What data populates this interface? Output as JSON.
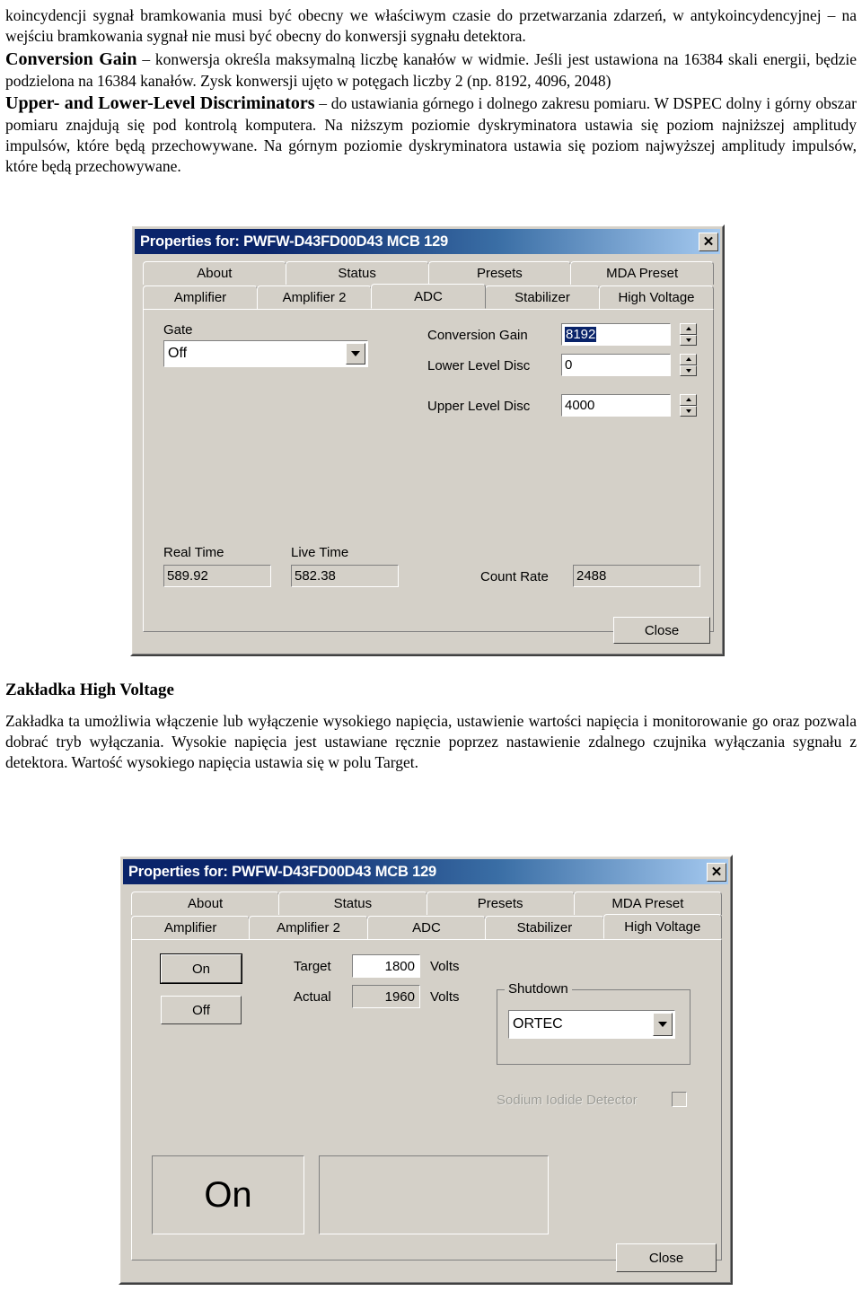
{
  "document": {
    "paragraph1": "koincydencji sygnał bramkowania musi być obecny we właściwym czasie do przetwarzania zdarzeń, w antykoincydencyjnej – na wejściu bramkowania sygnał nie musi być obecny do konwersji sygnału detektora.",
    "term1": "Conversion Gain",
    "paragraph2": " – konwersja określa maksymalną liczbę kanałów w widmie. Jeśli jest ustawiona na 16384 skali energii, będzie podzielona na 16384 kanałów. Zysk konwersji ujęto w potęgach liczby 2 (np. 8192, 4096, 2048)",
    "term2": "Upper- and Lower-Level Discriminators",
    "paragraph3": " – do ustawiania górnego i dolnego zakresu pomiaru. W DSPEC dolny i górny obszar pomiaru znajdują się pod kontrolą komputera. Na niższym poziomie dyskryminatora ustawia się poziom najniższej amplitudy impulsów, które będą przechowywane. Na górnym poziomie dyskryminatora ustawia się poziom najwyższej amplitudy impulsów, które będą przechowywane.",
    "heading_hv": "Zakładka High Voltage",
    "paragraph4": "Zakładka ta umożliwia włączenie lub wyłączenie wysokiego napięcia, ustawienie wartości napięcia i monitorowanie go oraz pozwala dobrać tryb wyłączania. Wysokie napięcia jest ustawiane ręcznie poprzez nastawienie zdalnego czujnika wyłączania sygnału z detektora. Wartość wysokiego napięcia ustawia się w polu Target."
  },
  "dialog_adc": {
    "title": "Properties for: PWFW-D43FD00D43 MCB 129",
    "close_icon_label": "✕",
    "tabs_top": [
      {
        "label": "About",
        "active": false
      },
      {
        "label": "Status",
        "active": false
      },
      {
        "label": "Presets",
        "active": false
      },
      {
        "label": "MDA Preset",
        "active": false
      }
    ],
    "tabs_bottom": [
      {
        "label": "Amplifier",
        "active": false
      },
      {
        "label": "Amplifier 2",
        "active": false
      },
      {
        "label": "ADC",
        "active": true
      },
      {
        "label": "Stabilizer",
        "active": false
      },
      {
        "label": "High Voltage",
        "active": false
      }
    ],
    "gate": {
      "label": "Gate",
      "value": "Off"
    },
    "fields": [
      {
        "label": "Conversion Gain",
        "value": "8192",
        "selected": true
      },
      {
        "label": "Lower Level Disc",
        "value": "0",
        "selected": false
      },
      {
        "label": "Upper Level Disc",
        "value": "4000",
        "selected": false
      }
    ],
    "status": {
      "real_time_label": "Real Time",
      "real_time_value": "589.92",
      "live_time_label": "Live Time",
      "live_time_value": "582.38",
      "count_rate_label": "Count Rate",
      "count_rate_value": "2488"
    },
    "close_button": "Close"
  },
  "dialog_hv": {
    "title": "Properties for: PWFW-D43FD00D43 MCB 129",
    "close_icon_label": "✕",
    "tabs_top": [
      {
        "label": "About",
        "active": false
      },
      {
        "label": "Status",
        "active": false
      },
      {
        "label": "Presets",
        "active": false
      },
      {
        "label": "MDA Preset",
        "active": false
      }
    ],
    "tabs_bottom": [
      {
        "label": "Amplifier",
        "active": false
      },
      {
        "label": "Amplifier 2",
        "active": false
      },
      {
        "label": "ADC",
        "active": false
      },
      {
        "label": "Stabilizer",
        "active": false
      },
      {
        "label": "High Voltage",
        "active": true
      }
    ],
    "on_button": "On",
    "off_button": "Off",
    "target_label": "Target",
    "target_value": "1800",
    "target_unit": "Volts",
    "actual_label": "Actual",
    "actual_value": "1960",
    "actual_unit": "Volts",
    "shutdown_group": "Shutdown",
    "shutdown_value": "ORTEC",
    "sodium_iodide_label": "Sodium Iodide Detector",
    "status_display": "On",
    "status_detail": "",
    "close_button": "Close"
  },
  "colors": {
    "titlebar_start": "#0a246a",
    "titlebar_end": "#a6caf0",
    "dialog_face": "#d4d0c8",
    "selection": "#0a246a",
    "disabled_text": "#9b9b95"
  }
}
